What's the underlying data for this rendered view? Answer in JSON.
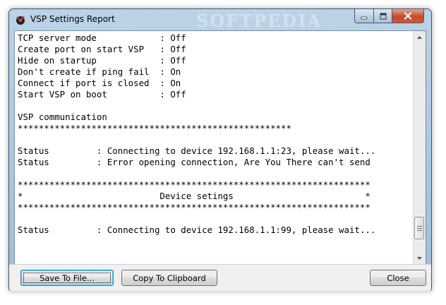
{
  "window": {
    "title": "VSP Settings Report",
    "watermark": "SOFTPEDIA"
  },
  "report_lines": [
    "TCP server mode            : Off",
    "Create port on start VSP   : Off",
    "Hide on startup            : Off",
    "Don't create if ping fail  : On",
    "Connect if port is closed  : On",
    "Start VSP on boot          : Off",
    "",
    "VSP communication",
    "****************************************************",
    "",
    "Status         : Connecting to device 192.168.1.1:23, please wait...",
    "Status         : Error opening connection, Are You There can't send",
    "",
    "*******************************************************************",
    "*                          Device setings                         *",
    "*******************************************************************",
    "",
    "Status         : Connecting to device 192.168.1.1:99, please wait..."
  ],
  "buttons": {
    "save": "Save To File...",
    "copy": "Copy To Clipboard",
    "close": "Close"
  },
  "colors": {
    "title_bar": "#bcd3e6",
    "close_control": "#c44a2c"
  }
}
